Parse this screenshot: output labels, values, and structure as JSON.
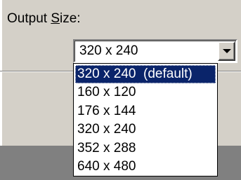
{
  "colors": {
    "dialog_background": "#d4d0c8",
    "selection_background": "#0a246a",
    "selection_text": "#ffffff"
  },
  "output_size": {
    "label_before_accel": "Output ",
    "label_accel": "S",
    "label_after_accel": "ize:",
    "selected_value": "320 x 240",
    "dropdown_icon": "chevron-down-icon",
    "options": [
      {
        "label": "320 x 240  (default)",
        "highlighted": true
      },
      {
        "label": "160 x 120",
        "highlighted": false
      },
      {
        "label": "176 x 144",
        "highlighted": false
      },
      {
        "label": "320 x 240",
        "highlighted": false
      },
      {
        "label": "352 x 288",
        "highlighted": false
      },
      {
        "label": "640 x 480",
        "highlighted": false
      }
    ]
  }
}
